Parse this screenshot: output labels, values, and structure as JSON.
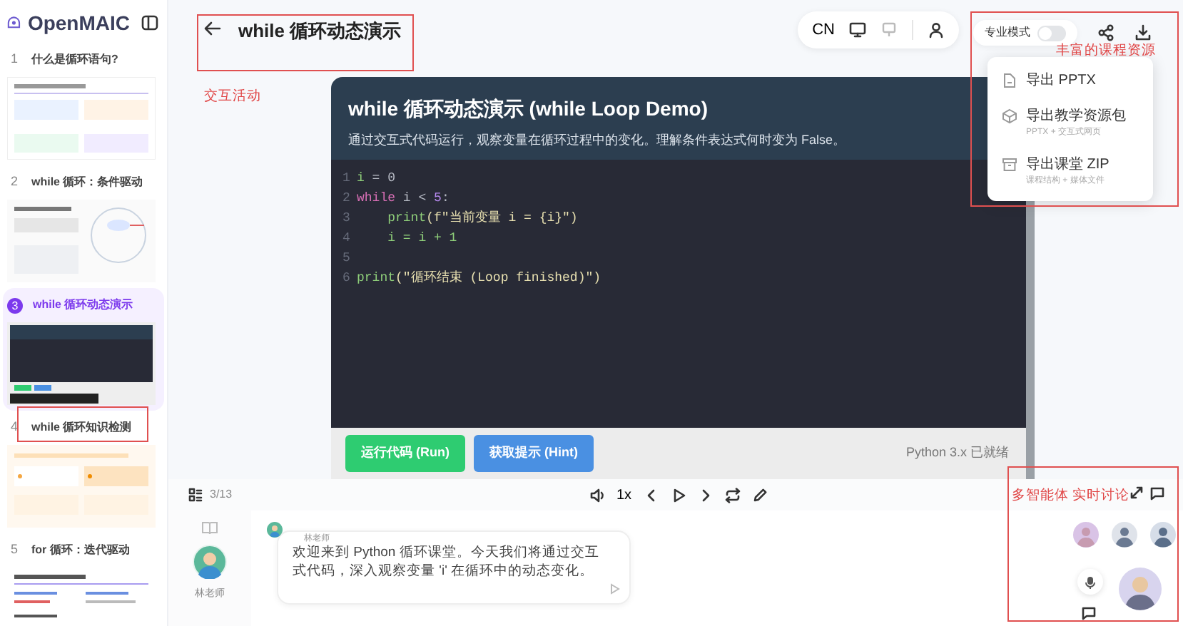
{
  "app": {
    "logo_text": "OpenMAIC"
  },
  "sidebar": {
    "items": [
      {
        "number": "1",
        "title": "什么是循环语句?",
        "selected": false,
        "kind": "comparison"
      },
      {
        "number": "2",
        "title": "while 循环：条件驱动",
        "selected": false,
        "kind": "diagram"
      },
      {
        "number": "3",
        "title": "while 循环动态演示",
        "selected": true,
        "kind": "code"
      },
      {
        "number": "4",
        "title": "while 循环知识检测",
        "selected": false,
        "kind": "quiz"
      },
      {
        "number": "5",
        "title": "for 循环：迭代驱动",
        "selected": false,
        "kind": "overview"
      }
    ]
  },
  "header": {
    "title": "while 循环动态演示"
  },
  "toolbar": {
    "language": "CN"
  },
  "pro_mode": {
    "label": "专业模式",
    "on": false
  },
  "export_menu": {
    "items": [
      {
        "kind": "file",
        "title": "导出 PPTX"
      },
      {
        "kind": "package",
        "title": "导出教学资源包",
        "subtitle": "PPTX + 交互式网页"
      },
      {
        "kind": "archive",
        "title": "导出课堂 ZIP",
        "subtitle": "课程结构 + 媒体文件"
      }
    ]
  },
  "slide": {
    "title": "while 循环动态演示 (while Loop Demo)",
    "description": "通过交互式代码运行，观察变量在循环过程中的变化。理解条件表达式何时变为 False。",
    "code_lines": [
      {
        "number": "1",
        "tokens": [
          {
            "kind": "var",
            "text": "i"
          },
          {
            "kind": "op",
            "text": " = 0"
          }
        ]
      },
      {
        "number": "2",
        "tokens": [
          {
            "kind": "kw",
            "text": "while"
          },
          {
            "kind": "op",
            "text": " i < "
          },
          {
            "kind": "num",
            "text": "5"
          },
          {
            "kind": "op",
            "text": ":"
          }
        ]
      },
      {
        "number": "3",
        "tokens": [
          {
            "kind": "fn",
            "text": "    print"
          },
          {
            "kind": "str",
            "text": "(f\"当前变量 i = {i}\")"
          }
        ]
      },
      {
        "number": "4",
        "tokens": [
          {
            "kind": "var",
            "text": "    i = i + 1"
          }
        ]
      },
      {
        "number": "5"
      },
      {
        "number": "6",
        "tokens": [
          {
            "kind": "fn",
            "text": "print"
          },
          {
            "kind": "str",
            "text": "(\"循环结束 (Loop finished)\")"
          }
        ]
      }
    ],
    "buttons": [
      {
        "kind": "run",
        "label": "运行代码 (Run)"
      },
      {
        "kind": "hint",
        "label": "获取提示 (Hint)"
      }
    ],
    "status": "Python 3.x 已就绪"
  },
  "playbar": {
    "page": "3/13",
    "speed": "1x"
  },
  "chat": {
    "teacher_name": "林老师",
    "message_author": "林老师",
    "message": "欢迎来到 Python 循环课堂。今天我们将通过交互式代码，深入观察变量 'i' 在循环中的动态变化。"
  },
  "annotations": [
    {
      "kind": "title"
    },
    {
      "kind": "activity",
      "label": "交互活动"
    },
    {
      "kind": "resources",
      "label": "丰富的课程资源"
    },
    {
      "kind": "quiz"
    },
    {
      "kind": "discussion",
      "label": "多智能体 实时讨论"
    }
  ]
}
